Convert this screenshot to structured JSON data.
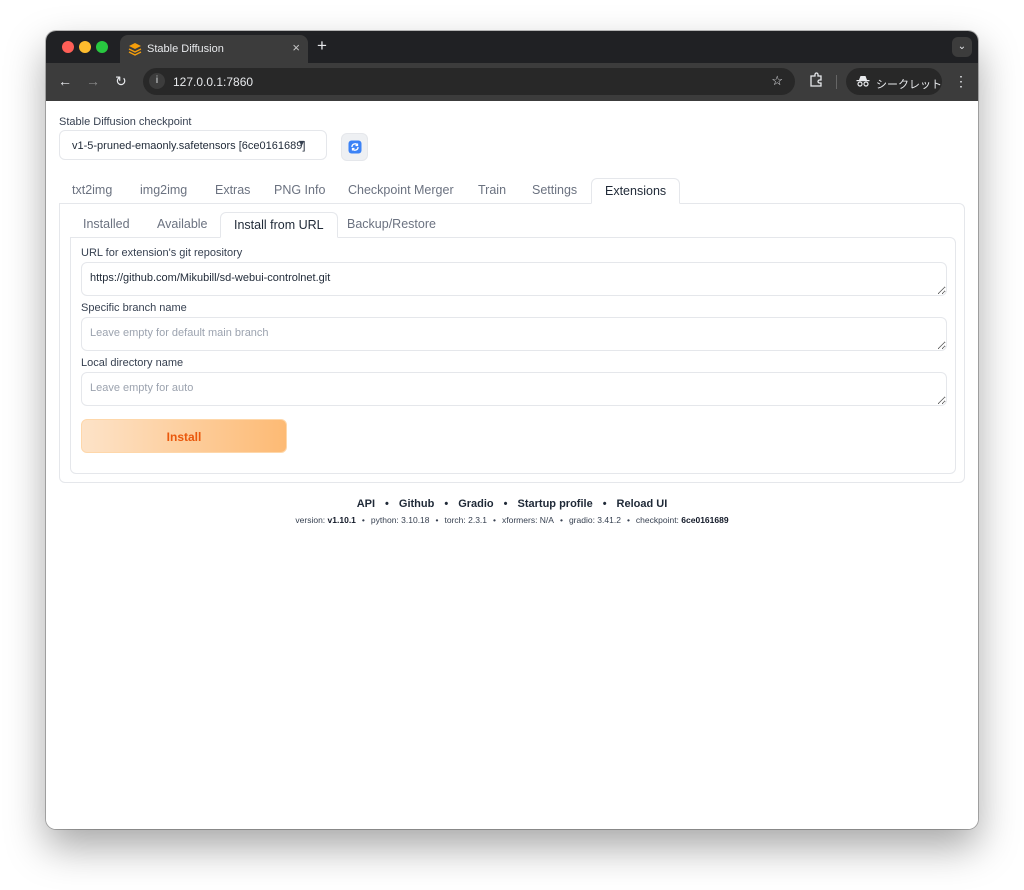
{
  "browser": {
    "tab_title": "Stable Diffusion",
    "tab_close": "×",
    "new_tab": "+",
    "url": "127.0.0.1:7860",
    "incognito_label": "シークレット"
  },
  "checkpoint": {
    "label": "Stable Diffusion checkpoint",
    "value": "v1-5-pruned-emaonly.safetensors [6ce0161689]"
  },
  "main_tabs": [
    {
      "label": "txt2img"
    },
    {
      "label": "img2img"
    },
    {
      "label": "Extras"
    },
    {
      "label": "PNG Info"
    },
    {
      "label": "Checkpoint Merger"
    },
    {
      "label": "Train"
    },
    {
      "label": "Settings"
    },
    {
      "label": "Extensions",
      "active": true
    }
  ],
  "sub_tabs": [
    {
      "label": "Installed"
    },
    {
      "label": "Available"
    },
    {
      "label": "Install from URL",
      "active": true
    },
    {
      "label": "Backup/Restore"
    }
  ],
  "form": {
    "url_label": "URL for extension's git repository",
    "url_value": "https://github.com/Mikubill/sd-webui-controlnet.git",
    "branch_label": "Specific branch name",
    "branch_placeholder": "Leave empty for default main branch",
    "dir_label": "Local directory name",
    "dir_placeholder": "Leave empty for auto",
    "install_label": "Install"
  },
  "footer": {
    "links": [
      "API",
      "Github",
      "Gradio",
      "Startup profile",
      "Reload UI"
    ],
    "separator": "•",
    "version_label": "version:",
    "version": "v1.10.1",
    "python": "python: 3.10.18",
    "torch": "torch: 2.3.1",
    "xformers": "xformers: N/A",
    "gradio": "gradio: 3.41.2",
    "checkpoint_label": "checkpoint:",
    "checkpoint": "6ce0161689"
  },
  "colors": {
    "accent": "#ea580c",
    "button_gradient_start": "#fde3c8",
    "button_gradient_end": "#fdba74",
    "browser_dark": "#202124"
  }
}
